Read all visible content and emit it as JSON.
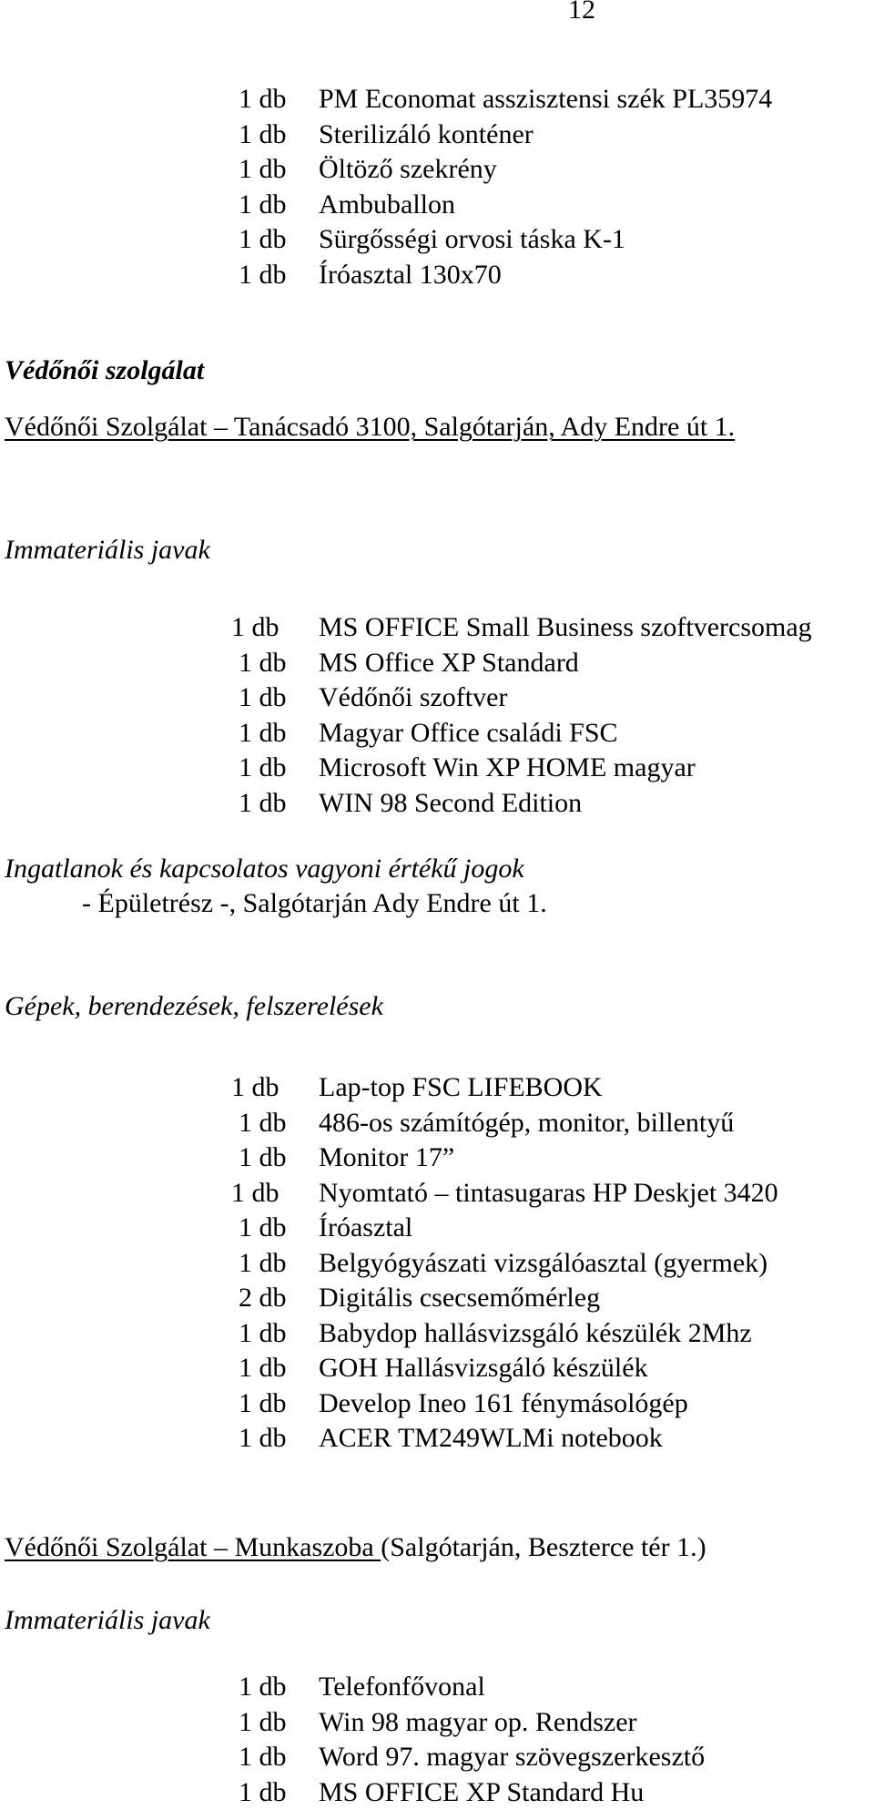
{
  "page_number": "12",
  "list1": [
    {
      "qty": "1 db",
      "name": "PM Economat asszisztensi szék PL35974"
    },
    {
      "qty": "1 db",
      "name": "Sterilizáló konténer"
    },
    {
      "qty": "1 db",
      "name": "Öltöző szekrény"
    },
    {
      "qty": "1 db",
      "name": "Ambuballon"
    },
    {
      "qty": "1 db",
      "name": "Sürgősségi orvosi táska K-1"
    },
    {
      "qty": "1 db",
      "name": "Íróasztal 130x70"
    }
  ],
  "section_vedonoi": {
    "title": "Védőnői szolgálat",
    "location_underlined": "Védőnői Szolgálat – Tanácsadó   3100, Salgótarján, Ady Endre út 1."
  },
  "immaterial1": {
    "heading": "Immateriális javak",
    "items": [
      {
        "qty": "1 db",
        "name": "MS OFFICE Small Business szoftvercsomag"
      },
      {
        "qty": "1 db",
        "name": "MS Office XP Standard"
      },
      {
        "qty": "1 db",
        "name": "Védőnői szoftver"
      },
      {
        "qty": "1 db",
        "name": "Magyar Office családi FSC"
      },
      {
        "qty": "1 db",
        "name": "Microsoft Win XP HOME magyar"
      },
      {
        "qty": "1 db",
        "name": "WIN 98 Second Edition"
      }
    ]
  },
  "real_estate": {
    "heading": "Ingatlanok és kapcsolatos vagyoni értékű jogok",
    "line": "- Épületrész -, Salgótarján Ady Endre út 1."
  },
  "machines": {
    "heading": "Gépek, berendezések, felszerelések",
    "items": [
      {
        "qty": "1 db",
        "name": "Lap-top FSC LIFEBOOK"
      },
      {
        "qty": "1 db",
        "name": "486-os számítógép, monitor, billentyű"
      },
      {
        "qty": "1 db",
        "name": "Monitor 17”"
      },
      {
        "qty": "1 db",
        "name": "Nyomtató – tintasugaras HP Deskjet 3420"
      },
      {
        "qty": "1 db",
        "name": "Íróasztal"
      },
      {
        "qty": "1 db",
        "name": "Belgyógyászati vizsgálóasztal (gyermek)"
      },
      {
        "qty": "2 db",
        "name": "Digitális csecsemőmérleg"
      },
      {
        "qty": "1 db",
        "name": "Babydop hallásvizsgáló készülék 2Mhz"
      },
      {
        "qty": "1 db",
        "name": "GOH Hallásvizsgáló készülék"
      },
      {
        "qty": "1 db",
        "name": "Develop Ineo 161 fénymásológép"
      },
      {
        "qty": "1 db",
        "name": "ACER TM249WLMi notebook"
      }
    ]
  },
  "section_munkaszoba": {
    "location_underlined": "Védőnői Szolgálat – Munkaszoba ",
    "location_rest": " (Salgótarján, Beszterce tér 1.)"
  },
  "immaterial2": {
    "heading": "Immateriális javak",
    "items": [
      {
        "qty": "1 db",
        "name": "Telefonfővonal"
      },
      {
        "qty": "1 db",
        "name": "Win 98 magyar op. Rendszer"
      },
      {
        "qty": "1 db",
        "name": "Word 97. magyar szövegszerkesztő"
      },
      {
        "qty": "1 db",
        "name": "MS OFFICE XP Standard Hu"
      }
    ]
  }
}
